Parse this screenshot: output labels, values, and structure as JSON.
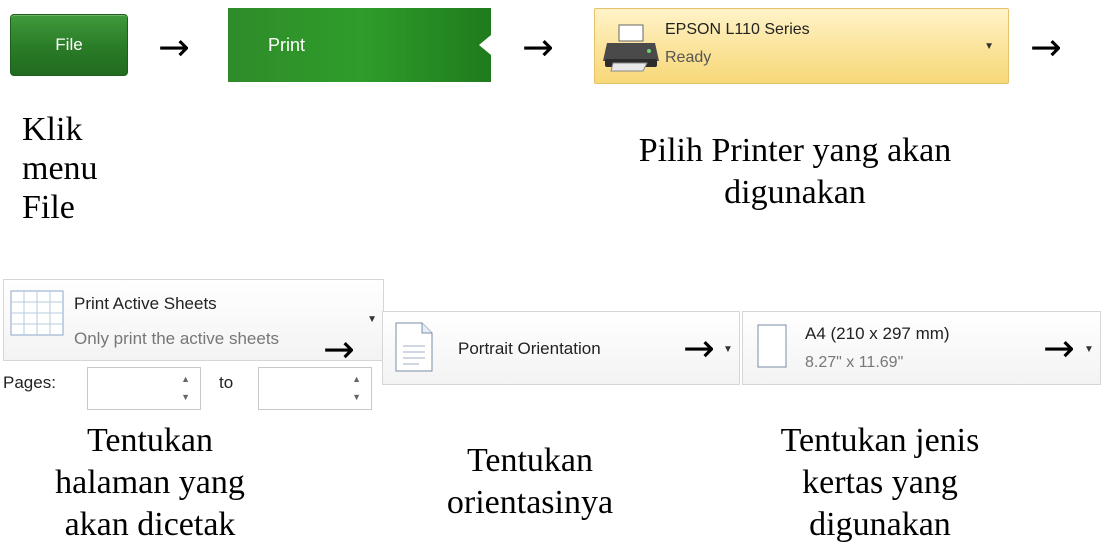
{
  "step1": {
    "button_label": "File",
    "caption": [
      "Klik",
      "menu",
      "File"
    ]
  },
  "step2": {
    "button_label": "Print"
  },
  "step3": {
    "printer_name": "EPSON L110 Series",
    "printer_status": "Ready",
    "caption": [
      "Pilih Printer yang akan",
      "digunakan"
    ]
  },
  "arrows": {
    "glyph": "→"
  },
  "step4": {
    "title": "Print Active Sheets",
    "subtitle": "Only print the active sheets",
    "pages_label": "Pages:",
    "to_label": "to",
    "caption": [
      "Tentukan",
      "halaman yang",
      "akan dicetak"
    ]
  },
  "step5": {
    "label": "Portrait Orientation",
    "caption": [
      "Tentukan",
      "orientasinya"
    ]
  },
  "step6": {
    "title": "A4 (210 x 297 mm)",
    "subtitle": "8.27\" x 11.69\"",
    "caption": [
      "Tentukan jenis",
      "kertas yang",
      "digunakan"
    ]
  },
  "colors": {
    "ribbon_green": "#2f8b2a",
    "printer_highlight": "#fbe39a"
  }
}
